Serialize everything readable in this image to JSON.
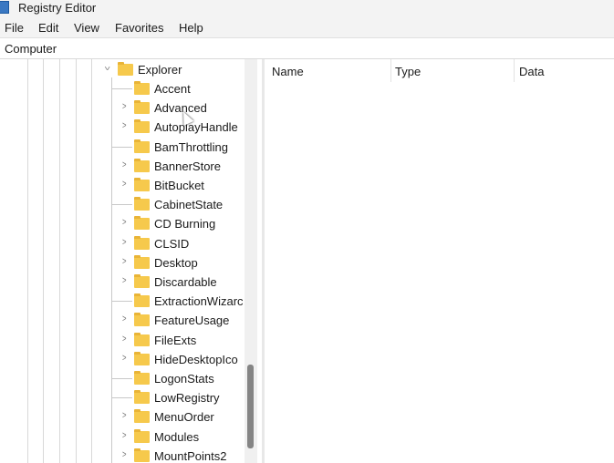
{
  "window": {
    "title": "Registry Editor"
  },
  "menu": [
    "File",
    "Edit",
    "View",
    "Favorites",
    "Help"
  ],
  "address": "Computer",
  "tree": {
    "parent": {
      "label": "Explorer",
      "expanded": true
    },
    "children": [
      {
        "label": "Accent",
        "expandable": false
      },
      {
        "label": "Advanced",
        "expandable": true
      },
      {
        "label": "AutoplayHandle",
        "expandable": true
      },
      {
        "label": "BamThrottling",
        "expandable": false
      },
      {
        "label": "BannerStore",
        "expandable": true
      },
      {
        "label": "BitBucket",
        "expandable": true
      },
      {
        "label": "CabinetState",
        "expandable": false
      },
      {
        "label": "CD Burning",
        "expandable": true
      },
      {
        "label": "CLSID",
        "expandable": true
      },
      {
        "label": "Desktop",
        "expandable": true
      },
      {
        "label": "Discardable",
        "expandable": true
      },
      {
        "label": "ExtractionWizarc",
        "expandable": false
      },
      {
        "label": "FeatureUsage",
        "expandable": true
      },
      {
        "label": "FileExts",
        "expandable": true
      },
      {
        "label": "HideDesktopIco",
        "expandable": true
      },
      {
        "label": "LogonStats",
        "expandable": false
      },
      {
        "label": "LowRegistry",
        "expandable": false
      },
      {
        "label": "MenuOrder",
        "expandable": true
      },
      {
        "label": "Modules",
        "expandable": true
      },
      {
        "label": "MountPoints2",
        "expandable": true
      }
    ]
  },
  "columns": [
    "Name",
    "Type",
    "Data"
  ]
}
